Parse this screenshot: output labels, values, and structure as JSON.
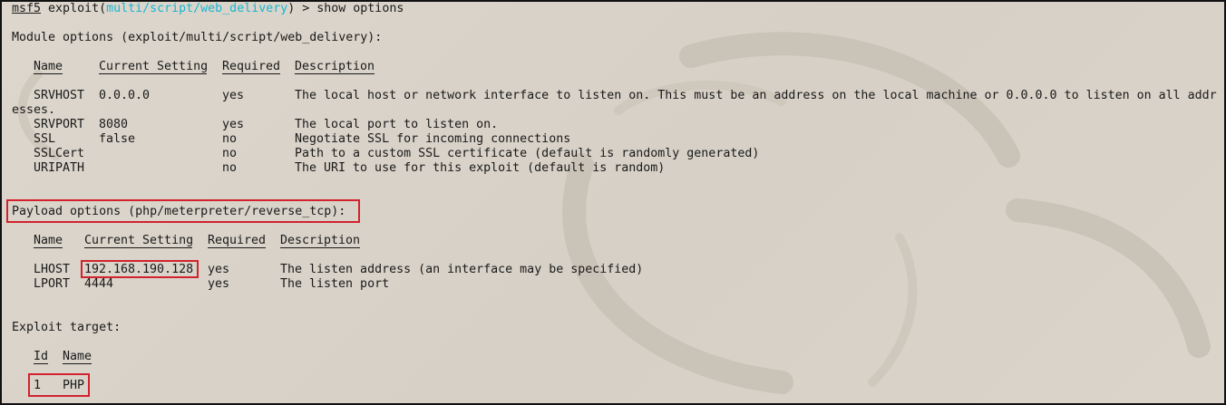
{
  "prompt": {
    "prefix": "msf5",
    "exploit_word": "exploit(",
    "module": "multi/script/web_delivery",
    "suffix": ") > ",
    "command": "show options"
  },
  "module_options": {
    "title": "Module options (exploit/multi/script/web_delivery):",
    "headers": [
      "Name",
      "Current Setting",
      "Required",
      "Description"
    ],
    "rows": [
      {
        "name": "SRVHOST",
        "setting": "0.0.0.0",
        "required": "yes",
        "description": "The local host or network interface to listen on. This must be an address on the local machine or 0.0.0.0 to listen on all addr"
      },
      {
        "name": "SRVPORT",
        "setting": "8080",
        "required": "yes",
        "description": "The local port to listen on."
      },
      {
        "name": "SSL",
        "setting": "false",
        "required": "no",
        "description": "Negotiate SSL for incoming connections"
      },
      {
        "name": "SSLCert",
        "setting": "",
        "required": "no",
        "description": "Path to a custom SSL certificate (default is randomly generated)"
      },
      {
        "name": "URIPATH",
        "setting": "",
        "required": "no",
        "description": "The URI to use for this exploit (default is random)"
      }
    ],
    "wrap_text": "esses."
  },
  "payload_options": {
    "title": "Payload options (php/meterpreter/reverse_tcp):",
    "headers": [
      "Name",
      "Current Setting",
      "Required",
      "Description"
    ],
    "rows": [
      {
        "name": "LHOST",
        "setting": "192.168.190.128",
        "required": "yes",
        "description": "The listen address (an interface may be specified)"
      },
      {
        "name": "LPORT",
        "setting": "4444",
        "required": "yes",
        "description": "The listen port"
      }
    ]
  },
  "exploit_target": {
    "title": "Exploit target:",
    "headers": [
      "Id",
      "Name"
    ],
    "rows": [
      {
        "id": "1",
        "name": "PHP"
      }
    ]
  },
  "colors": {
    "background": "#d9d3c9",
    "text": "#1a1a1a",
    "module_highlight": "#19b6d2",
    "annotation_box": "#d2222d"
  }
}
